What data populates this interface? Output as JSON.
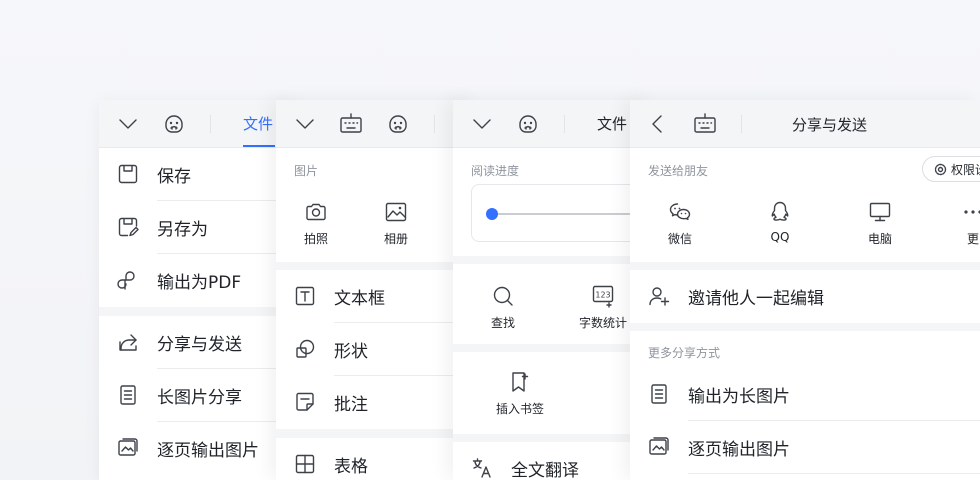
{
  "panel1": {
    "tab_file": "文件",
    "tab_color": "#3370ff",
    "menu": [
      {
        "icon": "save-icon",
        "label": "保存"
      },
      {
        "icon": "save-as-icon",
        "label": "另存为"
      },
      {
        "icon": "export-pdf-icon",
        "label": "输出为PDF"
      },
      {
        "icon": "share-icon",
        "label": "分享与发送"
      },
      {
        "icon": "long-image-icon",
        "label": "长图片分享"
      },
      {
        "icon": "image-pages-icon",
        "label": "逐页输出图片"
      }
    ]
  },
  "panel2": {
    "section_picture": "图片",
    "tiles": [
      {
        "icon": "camera-icon",
        "label": "拍照"
      },
      {
        "icon": "album-icon",
        "label": "相册"
      }
    ],
    "menu": [
      {
        "icon": "textbox-icon",
        "label": "文本框"
      },
      {
        "icon": "shape-icon",
        "label": "形状"
      },
      {
        "icon": "comment-icon",
        "label": "批注"
      },
      {
        "icon": "table-icon",
        "label": "表格"
      }
    ]
  },
  "panel3": {
    "tab_file": "文件",
    "reading_progress": "阅读进度",
    "progress_value": 0,
    "tiles": [
      {
        "icon": "search-icon",
        "label": "查找"
      },
      {
        "icon": "word-count-icon",
        "label": "字数统计"
      },
      {
        "icon": "bookmark-icon",
        "label": "插入书签"
      }
    ],
    "translate": "全文翻译"
  },
  "panel4": {
    "title": "分享与发送",
    "send_to_friends": "发送给朋友",
    "permission_button": "权限设",
    "share_targets": [
      {
        "icon": "wechat-icon",
        "label": "微信"
      },
      {
        "icon": "qq-icon",
        "label": "QQ"
      },
      {
        "icon": "computer-icon",
        "label": "电脑"
      },
      {
        "icon": "more-icon",
        "label": "更"
      }
    ],
    "invite": "邀请他人一起编辑",
    "more_share": "更多分享方式",
    "menu": [
      {
        "icon": "long-image-icon",
        "label": "输出为长图片"
      },
      {
        "icon": "image-pages-icon",
        "label": "逐页输出图片"
      }
    ]
  }
}
